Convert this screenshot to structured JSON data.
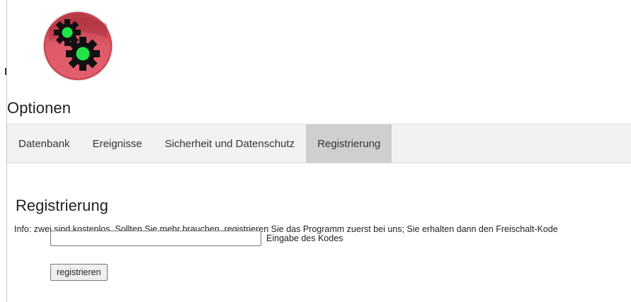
{
  "app": {
    "logo_icon": "gears-icon",
    "colors": {
      "logo_red": "#d9505f",
      "gear_dark": "#111111",
      "gear_center": "#22e34a",
      "tab_bar_bg": "#f2f2f2",
      "tab_active_bg": "#cfcfcf"
    }
  },
  "page": {
    "title": "Optionen"
  },
  "tabs": [
    {
      "label": "Datenbank",
      "active": false
    },
    {
      "label": "Ereignisse",
      "active": false
    },
    {
      "label": "Sicherheit und Datenschutz",
      "active": false
    },
    {
      "label": "Registrierung",
      "active": true
    }
  ],
  "registration": {
    "heading": "Registrierung",
    "info": "Info: zwei sind kostenlos. Sollten Sie mehr brauchen, registrieren Sie das Programm zuerst bei uns; Sie erhalten dann den Freischalt-Kode",
    "code_input_value": "",
    "code_input_label": "Eingabe des Kodes",
    "register_button_label": "registrieren"
  }
}
